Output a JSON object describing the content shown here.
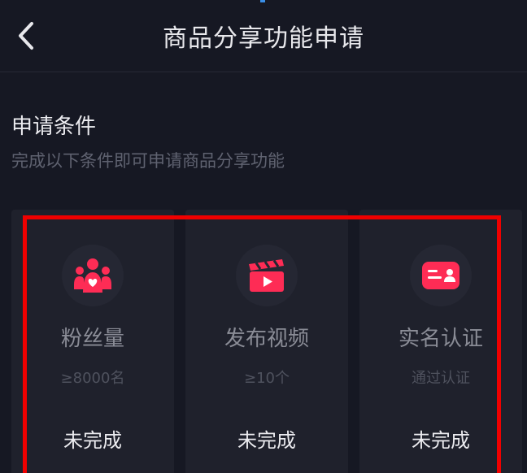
{
  "header": {
    "back_icon": "chevron-left-icon",
    "title": "商品分享功能申请"
  },
  "section": {
    "title": "申请条件",
    "subtitle": "完成以下条件即可申请商品分享功能"
  },
  "cards": [
    {
      "icon": "fans-icon",
      "label": "粉丝量",
      "requirement": "≥8000名",
      "status": "未完成"
    },
    {
      "icon": "video-clapper-icon",
      "label": "发布视频",
      "requirement": "≥10个",
      "status": "未完成"
    },
    {
      "icon": "id-card-icon",
      "label": "实名认证",
      "requirement": "通过认证",
      "status": "未完成"
    }
  ],
  "colors": {
    "background": "#161823",
    "card": "#1f212c",
    "icon_accent": "#fe2c55",
    "highlight_box": "#f00000"
  }
}
